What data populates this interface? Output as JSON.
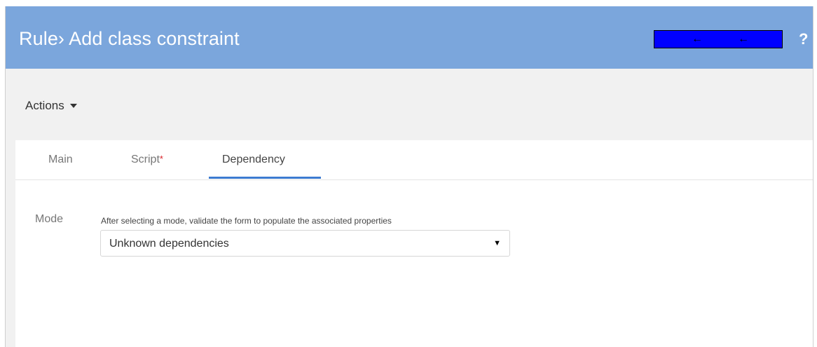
{
  "header": {
    "title": "Rule› Add class constraint",
    "history_icon": "navigation-history-icon",
    "help_label": "?"
  },
  "toolbar": {
    "actions_label": "Actions"
  },
  "tabs": [
    {
      "label": "Main",
      "active": false
    },
    {
      "label": "Script",
      "required_marker": "*",
      "active": false
    },
    {
      "label": "Dependency",
      "active": true
    }
  ],
  "form": {
    "mode_label": "Mode",
    "mode_hint": "After selecting a mode, validate the form to populate the associated properties",
    "mode_value": "Unknown dependencies"
  },
  "colors": {
    "header_bg": "#7ba6dc",
    "active_tab_underline": "#3d7bd1",
    "required_marker": "#d9242b"
  }
}
